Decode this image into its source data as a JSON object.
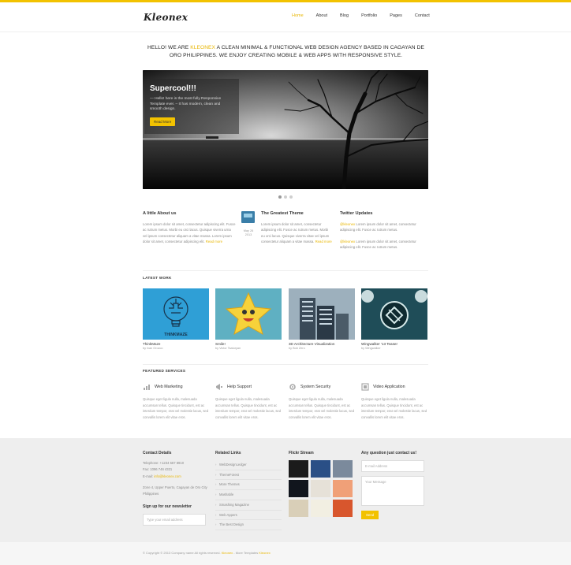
{
  "brand": {
    "logo": "Kleonex",
    "accent": "#f2c200"
  },
  "nav": {
    "items": [
      "Home",
      "About",
      "Blog",
      "Portfolio",
      "Pages",
      "Contact"
    ],
    "active": "Home"
  },
  "intro": {
    "before": "Hello! We are ",
    "highlight": "Kleonex",
    "after": " a clean minimal & functional web design agency based in Cagayan de Oro Philippines. We enjoy creating mobile & web apps with responsive style."
  },
  "slider": {
    "title": "Supercool!!!",
    "text": "— Hello! here is the most fully Responsive Template ever. – It has modern, clean and smooth design.",
    "button": "Read More",
    "dots": 3,
    "active_dot": 2
  },
  "about": {
    "title": "A little About us",
    "text": "Lorem ipsum dolor sit amet, consectetur adipiscing elit. Fusce ac rutrum metus. Morbi eu orci lacus. Quisque viverra urna vel ipsum consectetur aliquam a vitae massa. Lorem ipsum dolor sit amet, consectetur adipiscing elit.",
    "link": "Read more"
  },
  "theme": {
    "title": "The Greatest Theme",
    "date": "May 26 2013",
    "text": "Lorem ipsum dolor sit amet, consectetur adipiscing elit. Fusce ac rutrum metus. Morbi eu orci lacus. Quisque viverra vitae vel ipsum consectetur aliquam a vitae massa.",
    "link": "Read more"
  },
  "twitter": {
    "title": "Twitter Updates",
    "tweets": [
      {
        "user": "@kleonex",
        "text": "Lorem ipsum dolor sit amet, consectetur adipiscing elit. Fusce ac rutrum metus."
      },
      {
        "user": "@kleonex",
        "text": "Lorem ipsum dolor sit amet, consectetur adipiscing elit. Fusce ac rutrum metus."
      }
    ]
  },
  "latest_work": {
    "label": "LATEST WORK",
    "items": [
      {
        "title": "ThinkMaze",
        "sub": "by Ivan Orozco",
        "thumb_label": "THINKMAZE"
      },
      {
        "title": "Smile!",
        "sub": "by Victor Tsaturyan"
      },
      {
        "title": "3D Architecture Visualization",
        "sub": "by Bob Zero"
      },
      {
        "title": "Wingwalker '13 Teaser",
        "sub": "by Wingwalker"
      }
    ]
  },
  "services": {
    "label": "FEATURED SERVICES",
    "items": [
      {
        "title": "Web Marketing",
        "icon": "chart-icon",
        "text": "Quisque eget ligula nulla, malesuada accumsan tellus. Quisque tincidunt, est ac interdum tempor, erat vel molestie lacus, sed convallis lorem elit vitae eros."
      },
      {
        "title": "Help Support",
        "icon": "megaphone-icon",
        "text": "Quisque eget ligula nulla, malesuada accumsan tellus. Quisque tincidunt, est ac interdum tempor, erat vel molestie lacus, sed convallis lorem elit vitae eros."
      },
      {
        "title": "System Security",
        "icon": "gear-icon",
        "text": "Quisque eget ligula nulla, malesuada accumsan tellus. Quisque tincidunt, est ac interdum tempor, erat vel molestie lacus, sed convallis lorem elit vitae eros."
      },
      {
        "title": "Video Application",
        "icon": "film-icon",
        "text": "Quisque eget ligula nulla, malesuada accumsan tellus. Quisque tincidunt, est ac interdum tempor, erat vel molestie lacus, sed convallis lorem elit vitae eros."
      }
    ]
  },
  "footer": {
    "contact": {
      "title": "Contact Details",
      "telephone": "Telephone: +1234 567 8910",
      "fax": "Fax: 1096 746 4321",
      "email_label": "E-mail: ",
      "email": "info@kleonex.com",
      "address": "Zone 4, Upper Puerto, Cagayan de Oro City Philippines",
      "newsletter_title": "Sign up for our newsletter",
      "newsletter_placeholder": "Type your email address"
    },
    "links": {
      "title": "Related Links",
      "items": [
        "WebDesignLedger",
        "ThemeForest",
        "More Themes",
        "Mashable",
        "Smashing Magazine",
        "Web Appers",
        "The Best Design"
      ]
    },
    "flickr": {
      "title": "Flickr Stream",
      "colors": [
        "#1b1b1b",
        "#2a4f86",
        "#7b8a9c",
        "#11151d",
        "#e6e1d8",
        "#f0a078",
        "#d9cfb8",
        "#f2efe2",
        "#d8562d"
      ]
    },
    "form": {
      "title": "Any question just contact us!",
      "email_placeholder": "E-mail Address",
      "message_placeholder": "Your Message",
      "send": "Send"
    }
  },
  "copyright": {
    "text": "© Copyright © 2013 Company name All rights reserved. ",
    "link1": "Kleonex",
    "middle": " - More Templates ",
    "link2": "Kleonex"
  }
}
